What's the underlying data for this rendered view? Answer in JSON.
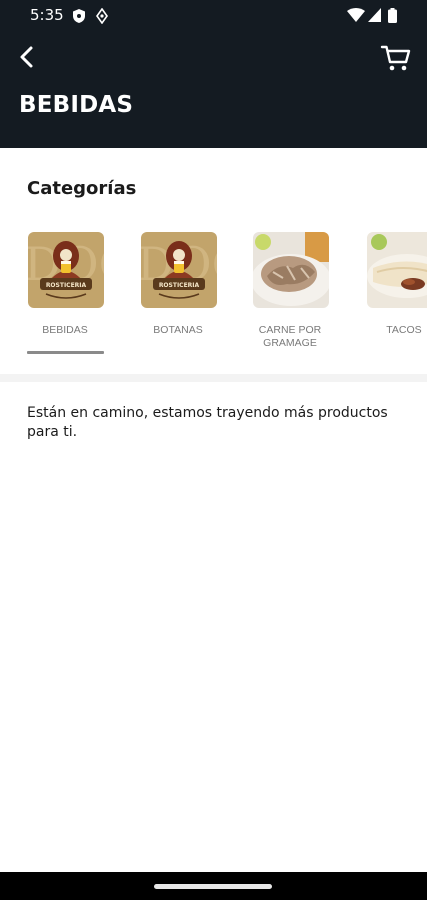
{
  "status_bar": {
    "time": "5:35"
  },
  "header": {
    "title": "BEBIDAS",
    "back_icon": "chevron-left-icon",
    "cart_icon": "cart-icon"
  },
  "categories": {
    "title": "Categorías",
    "items": [
      {
        "label": "BEBIDAS",
        "selected": true
      },
      {
        "label": "BOTANAS",
        "selected": false
      },
      {
        "label": "CARNE POR GRAMAGE",
        "selected": false
      },
      {
        "label": "TACOS",
        "selected": false
      }
    ]
  },
  "empty_message": "Están en camino, estamos trayendo más productos para ti.",
  "colors": {
    "header_bg": "#141b22",
    "logo_tan": "#c2a46b",
    "underline": "#8a8a8a"
  }
}
